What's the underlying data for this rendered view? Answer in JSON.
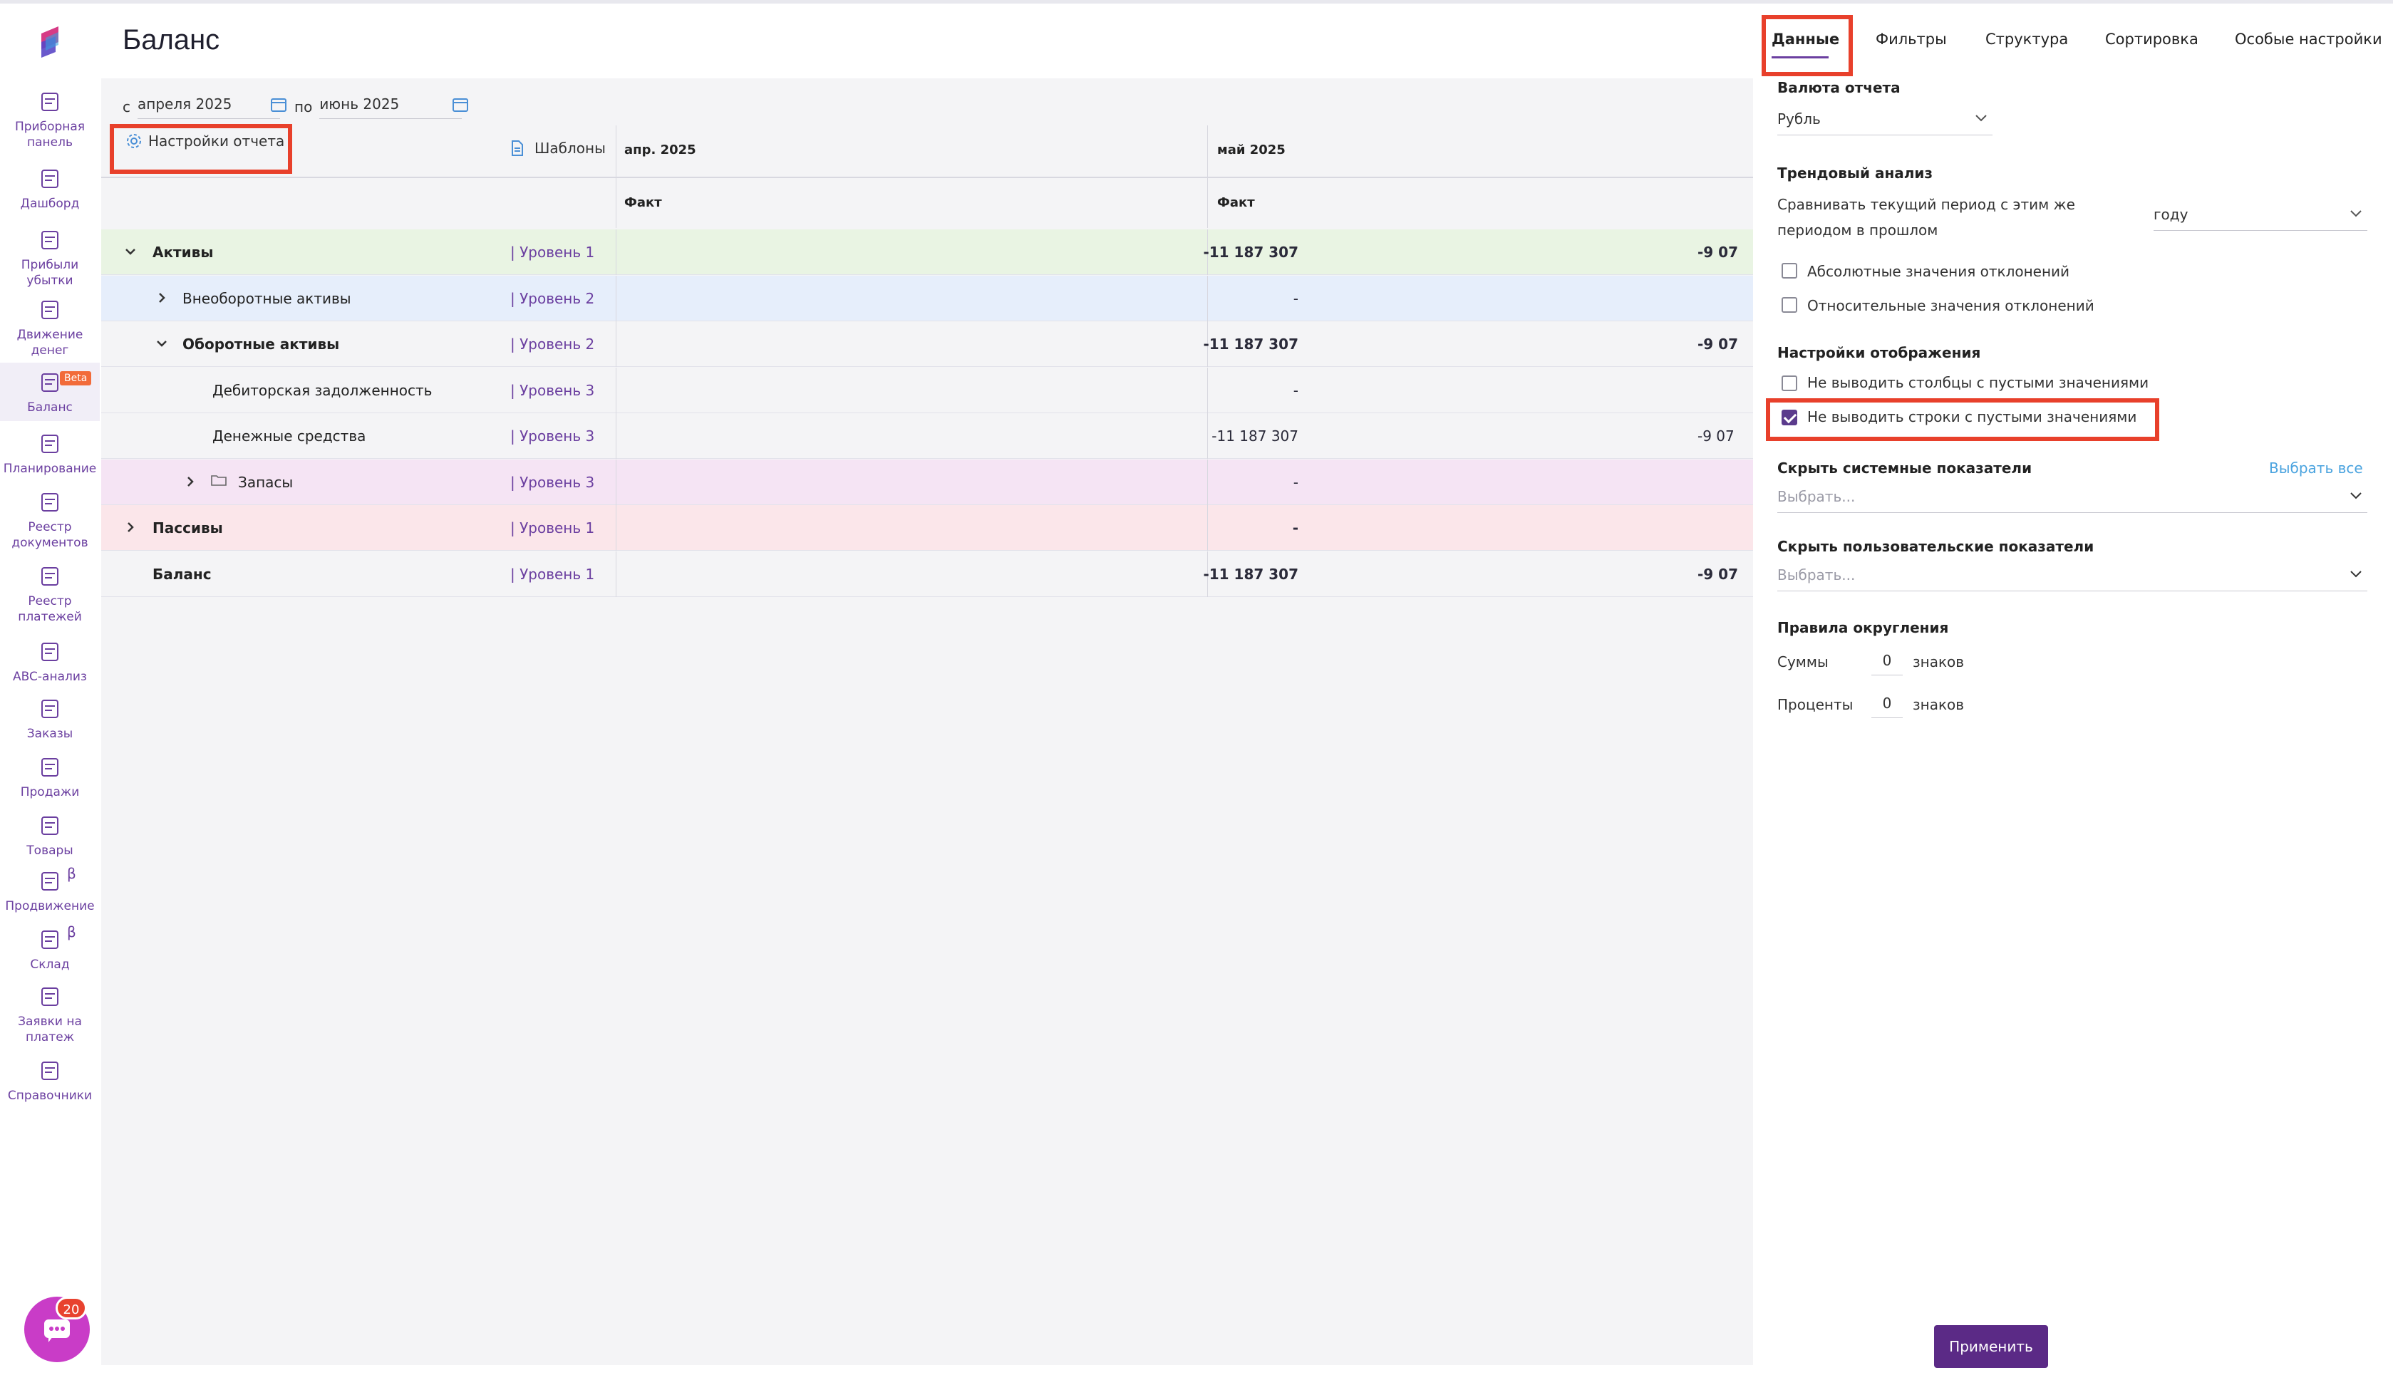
{
  "page": {
    "title": "Баланс"
  },
  "sidebar": {
    "items": [
      {
        "label": "Приборная\nпанель",
        "icon": "dashboard-panel-icon"
      },
      {
        "label": "Дашборд",
        "icon": "pie-chart-icon"
      },
      {
        "label": "Прибыли\nубытки",
        "icon": "bar-chart-icon"
      },
      {
        "label": "Движение\nденег",
        "icon": "money-flow-icon"
      },
      {
        "label": "Баланс",
        "icon": "balance-icon",
        "badge": "Beta",
        "active": true
      },
      {
        "label": "Планирование",
        "icon": "target-icon"
      },
      {
        "label": "Реестр\nдокументов",
        "icon": "documents-icon"
      },
      {
        "label": "Реестр\nплатежей",
        "icon": "wallet-icon"
      },
      {
        "label": "ABC-анализ",
        "icon": "abc-icon"
      },
      {
        "label": "Заказы",
        "icon": "shopping-bag-icon"
      },
      {
        "label": "Продажи",
        "icon": "dollar-icon"
      },
      {
        "label": "Товары",
        "icon": "boxes-icon"
      },
      {
        "label": "Продвижение",
        "icon": "megaphone-icon",
        "greek": "β"
      },
      {
        "label": "Склад",
        "icon": "warehouse-icon",
        "greek": "β"
      },
      {
        "label": "Заявки на\nплатеж",
        "icon": "payment-request-icon"
      },
      {
        "label": "Справочники",
        "icon": "folder-icon"
      }
    ],
    "chat_badge": "20"
  },
  "filters": {
    "from_label": "с",
    "from_value": "апреля 2025",
    "to_label": "по",
    "to_value": "июнь 2025",
    "settings_label": "Настройки отчета",
    "templates_label": "Шаблоны"
  },
  "table": {
    "periods": [
      "апр. 2025",
      "май 2025"
    ],
    "subheaders": [
      "Факт",
      "Факт"
    ],
    "rows": [
      {
        "name": "Активы",
        "level": "| Уровень 1",
        "v1": "-11 187 307",
        "v2": "-9 07"
      },
      {
        "name": "Внеоборотные активы",
        "level": "| Уровень 2",
        "v1": "-",
        "v2": ""
      },
      {
        "name": "Оборотные активы",
        "level": "| Уровень 2",
        "v1": "-11 187 307",
        "v2": "-9 07"
      },
      {
        "name": "Дебиторская задолженность",
        "level": "| Уровень 3",
        "v1": "-",
        "v2": ""
      },
      {
        "name": "Денежные средства",
        "level": "| Уровень 3",
        "v1": "-11 187 307",
        "v2": "-9 07"
      },
      {
        "name": "Запасы",
        "level": "| Уровень 3",
        "v1": "-",
        "v2": ""
      },
      {
        "name": "Пассивы",
        "level": "| Уровень 1",
        "v1": "-",
        "v2": ""
      },
      {
        "name": "Баланс",
        "level": "| Уровень 1",
        "v1": "-11 187 307",
        "v2": "-9 07"
      }
    ],
    "row_colors": [
      "#e9f4e3",
      "#e6eefb",
      "#f4f4f6",
      "#f4f4f6",
      "#f4f4f6",
      "#f5e4f4",
      "#fbe6ea",
      "#f4f4f6"
    ]
  },
  "panel": {
    "tabs": [
      "Данные",
      "Фильтры",
      "Структура",
      "Сортировка",
      "Особые настройки"
    ],
    "currency": {
      "title": "Валюта отчета",
      "value": "Рубль"
    },
    "trend": {
      "title": "Трендовый анализ",
      "compare_text": "Сравнивать текущий период с этим же периодом в прошлом",
      "compare_value": "году",
      "abs_label": "Абсолютные значения отклонений",
      "rel_label": "Относительные значения отклонений"
    },
    "display": {
      "title": "Настройки отображения",
      "no_empty_cols": "Не выводить столбцы с пустыми значениями",
      "no_empty_rows": "Не выводить строки с пустыми значениями"
    },
    "hide_system": {
      "title": "Скрыть системные показатели",
      "select_all": "Выбрать все",
      "placeholder": "Выбрать..."
    },
    "hide_user": {
      "title": "Скрыть пользовательские показатели",
      "placeholder": "Выбрать..."
    },
    "rounding": {
      "title": "Правила округления",
      "sums_label": "Суммы",
      "sums_value": "0",
      "percents_label": "Проценты",
      "percents_value": "0",
      "unit": "знаков"
    },
    "apply_label": "Применить"
  },
  "colors": {
    "accent": "#6b3fa0",
    "highlight": "#e8402b",
    "apply": "#5b2a86"
  }
}
